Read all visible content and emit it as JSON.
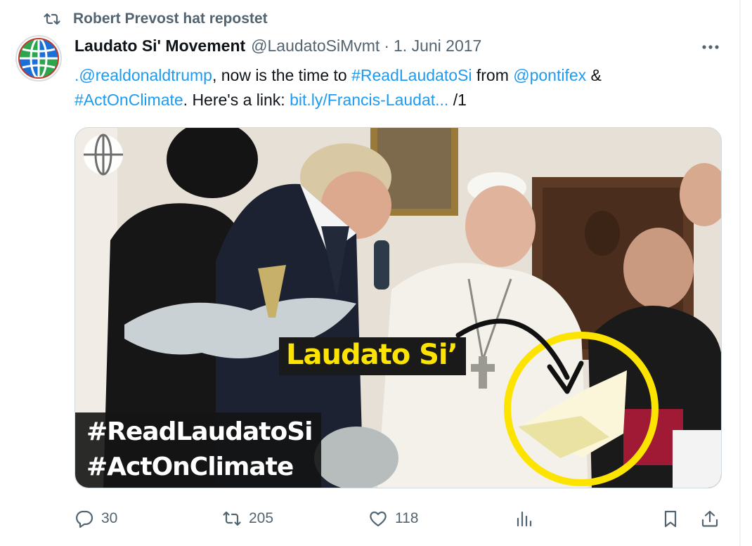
{
  "repost": {
    "label": "Robert Prevost hat repostet",
    "icon": "repost-icon"
  },
  "tweet": {
    "author_name": "Laudato Si' Movement",
    "author_handle": "@LaudatoSiMvmt",
    "separator": "·",
    "date": "1. Juni 2017",
    "more_label": "•••",
    "text": {
      "mention_trump": ".@realdonaldtrump",
      "seg1": ", now is the time to ",
      "hashtag_read": "#ReadLaudatoSi",
      "seg2": " from ",
      "mention_pontifex": "@pontifex",
      "seg3": " &",
      "hashtag_climate": "#ActOnClimate",
      "seg4": ". Here's a link: ",
      "link": "bit.ly/Francis-Laudat...",
      "seg5": " /1"
    }
  },
  "media": {
    "caption": "Laudato Si’",
    "hashtags": [
      "#ReadLaudatoSi",
      "#ActOnClimate"
    ],
    "highlight_color": "#fde300"
  },
  "actions": {
    "replies": "30",
    "reposts": "205",
    "likes": "118"
  },
  "colors": {
    "link": "#1d9bf0",
    "secondary_text": "#536471",
    "primary_text": "#0f1419"
  }
}
